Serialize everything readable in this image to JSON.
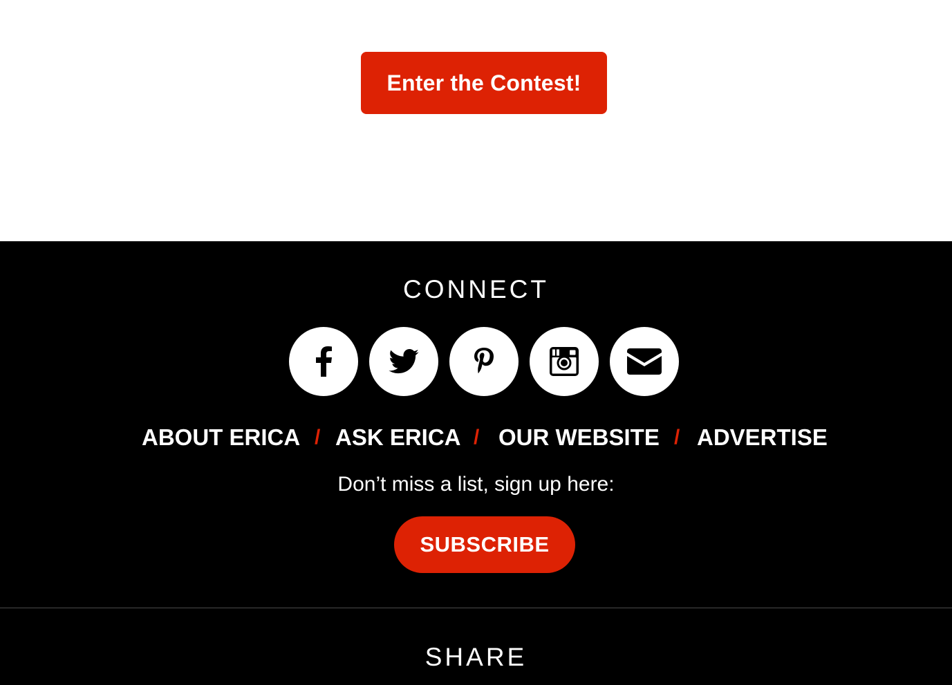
{
  "top": {
    "contest_button_label": "Enter the Contest!"
  },
  "footer": {
    "connect_title": "CONNECT",
    "social_icons": [
      "facebook-icon",
      "twitter-icon",
      "pinterest-icon",
      "instagram-icon",
      "email-icon"
    ],
    "nav": {
      "about": "ABOUT ERICA",
      "ask": "ASK ERICA",
      "website": "OUR WEBSITE",
      "advertise": "ADVERTISE",
      "separator": "/"
    },
    "signup_text": "Don’t miss a list, sign up here:",
    "subscribe_label": "SUBSCRIBE",
    "share_title": "SHARE"
  },
  "colors": {
    "accent": "#dd2204",
    "footer_bg": "#000000",
    "page_bg": "#ffffff"
  }
}
